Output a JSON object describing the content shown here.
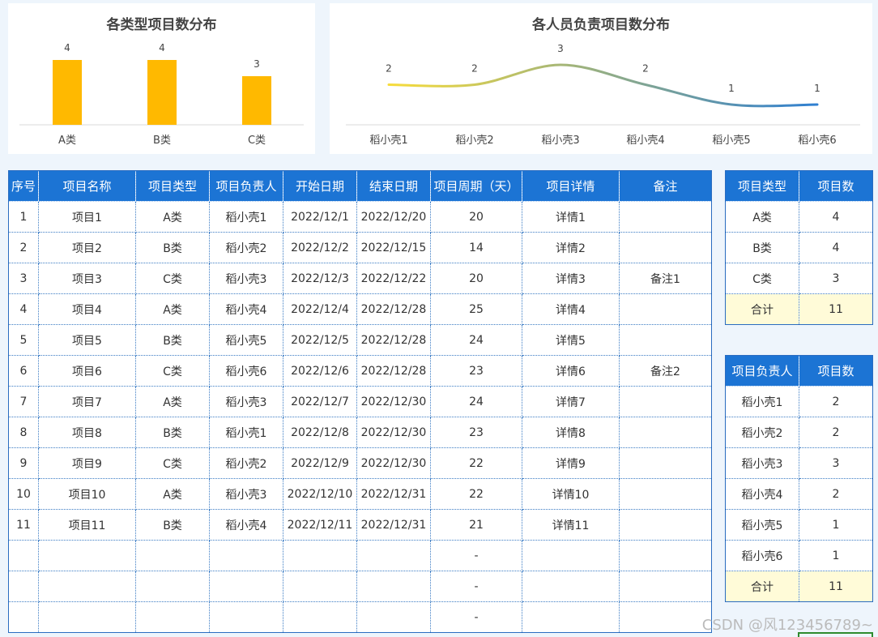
{
  "chart_data": [
    {
      "type": "bar",
      "title": "各类型项目数分布",
      "categories": [
        "A类",
        "B类",
        "C类"
      ],
      "values": [
        4,
        4,
        3
      ],
      "color": "#ffb900",
      "ylim": [
        0,
        4
      ],
      "grid": false,
      "legend": "none"
    },
    {
      "type": "line",
      "title": "各人员负责项目数分布",
      "categories": [
        "稻小壳1",
        "稻小壳2",
        "稻小壳3",
        "稻小壳4",
        "稻小壳5",
        "稻小壳6"
      ],
      "values": [
        2,
        2,
        3,
        2,
        1,
        1
      ],
      "smooth": true,
      "gradient": [
        "#f7dc3a",
        "#2f7fd1"
      ],
      "grid": false,
      "legend": "none"
    }
  ],
  "main_table": {
    "headers": [
      "序号",
      "项目名称",
      "项目类型",
      "项目负责人",
      "开始日期",
      "结束日期",
      "项目周期（天）",
      "项目详情",
      "备注"
    ],
    "rows": [
      [
        "1",
        "项目1",
        "A类",
        "稻小壳1",
        "2022/12/1",
        "2022/12/20",
        "20",
        "详情1",
        ""
      ],
      [
        "2",
        "项目2",
        "B类",
        "稻小壳2",
        "2022/12/2",
        "2022/12/15",
        "14",
        "详情2",
        ""
      ],
      [
        "3",
        "项目3",
        "C类",
        "稻小壳3",
        "2022/12/3",
        "2022/12/22",
        "20",
        "详情3",
        "备注1"
      ],
      [
        "4",
        "项目4",
        "A类",
        "稻小壳4",
        "2022/12/4",
        "2022/12/28",
        "25",
        "详情4",
        ""
      ],
      [
        "5",
        "项目5",
        "B类",
        "稻小壳5",
        "2022/12/5",
        "2022/12/28",
        "24",
        "详情5",
        ""
      ],
      [
        "6",
        "项目6",
        "C类",
        "稻小壳6",
        "2022/12/6",
        "2022/12/28",
        "23",
        "详情6",
        "备注2"
      ],
      [
        "7",
        "项目7",
        "A类",
        "稻小壳3",
        "2022/12/7",
        "2022/12/30",
        "24",
        "详情7",
        ""
      ],
      [
        "8",
        "项目8",
        "B类",
        "稻小壳1",
        "2022/12/8",
        "2022/12/30",
        "23",
        "详情8",
        ""
      ],
      [
        "9",
        "项目9",
        "C类",
        "稻小壳2",
        "2022/12/9",
        "2022/12/30",
        "22",
        "详情9",
        ""
      ],
      [
        "10",
        "项目10",
        "A类",
        "稻小壳3",
        "2022/12/10",
        "2022/12/31",
        "22",
        "详情10",
        ""
      ],
      [
        "11",
        "项目11",
        "B类",
        "稻小壳4",
        "2022/12/11",
        "2022/12/31",
        "21",
        "详情11",
        ""
      ],
      [
        "",
        "",
        "",
        "",
        "",
        "",
        "-",
        "",
        ""
      ],
      [
        "",
        "",
        "",
        "",
        "",
        "",
        "-",
        "",
        ""
      ],
      [
        "",
        "",
        "",
        "",
        "",
        "",
        "-",
        "",
        ""
      ]
    ]
  },
  "type_summary": {
    "headers": [
      "项目类型",
      "项目数"
    ],
    "rows": [
      [
        "A类",
        "4"
      ],
      [
        "B类",
        "4"
      ],
      [
        "C类",
        "3"
      ]
    ],
    "total": [
      "合计",
      "11"
    ]
  },
  "person_summary": {
    "headers": [
      "项目负责人",
      "项目数"
    ],
    "rows": [
      [
        "稻小壳1",
        "2"
      ],
      [
        "稻小壳2",
        "2"
      ],
      [
        "稻小壳3",
        "3"
      ],
      [
        "稻小壳4",
        "2"
      ],
      [
        "稻小壳5",
        "1"
      ],
      [
        "稻小壳6",
        "1"
      ]
    ],
    "total": [
      "合计",
      "11"
    ]
  },
  "watermark": "CSDN @风123456789~"
}
